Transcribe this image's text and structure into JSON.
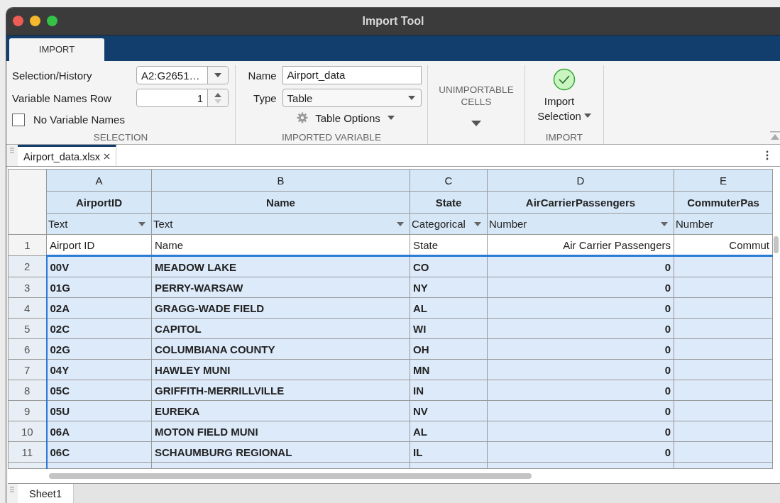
{
  "window": {
    "title": "Import Tool"
  },
  "ribbon_tabs": [
    {
      "label": "IMPORT",
      "selected": true
    }
  ],
  "selection": {
    "history_label": "Selection/History",
    "history_value": "A2:G2651…",
    "names_row_label": "Variable Names Row",
    "names_row_value": "1",
    "no_names_label": "No Variable Names",
    "no_names_checked": false,
    "section": "SELECTION"
  },
  "imported_variable": {
    "name_label": "Name",
    "name_value": "Airport_data",
    "type_label": "Type",
    "type_value": "Table",
    "options": "Table Options",
    "section": "IMPORTED VARIABLE"
  },
  "unimportable": {
    "label": "UNIMPORTABLE CELLS"
  },
  "import": {
    "button": "Import Selection",
    "section": "IMPORT"
  },
  "file_tabs": [
    {
      "label": "Airport_data.xlsx",
      "selected": true
    }
  ],
  "table": {
    "columns": [
      {
        "letter": "A",
        "name": "AirportID",
        "type": "Text",
        "kind": "text",
        "dropdown": true
      },
      {
        "letter": "B",
        "name": "Name",
        "type": "Text",
        "kind": "text",
        "dropdown": true
      },
      {
        "letter": "C",
        "name": "State",
        "type": "Categorical",
        "kind": "text",
        "dropdown": true
      },
      {
        "letter": "D",
        "name": "AirCarrierPassengers",
        "type": "Number",
        "kind": "numeric",
        "dropdown": true
      },
      {
        "letter": "E",
        "name": "CommuterPas",
        "type": "Number",
        "kind": "numeric",
        "dropdown": false
      }
    ],
    "rows": [
      {
        "number": "1",
        "selected": false,
        "cells": [
          "Airport ID",
          "Name",
          "State",
          "Air Carrier Passengers",
          "Commut"
        ]
      },
      {
        "number": "2",
        "selected": true,
        "cells": [
          "00V",
          "MEADOW LAKE",
          "CO",
          "0",
          ""
        ]
      },
      {
        "number": "3",
        "selected": true,
        "cells": [
          "01G",
          "PERRY-WARSAW",
          "NY",
          "0",
          ""
        ]
      },
      {
        "number": "4",
        "selected": true,
        "cells": [
          "02A",
          "GRAGG-WADE FIELD",
          "AL",
          "0",
          ""
        ]
      },
      {
        "number": "5",
        "selected": true,
        "cells": [
          "02C",
          "CAPITOL",
          "WI",
          "0",
          ""
        ]
      },
      {
        "number": "6",
        "selected": true,
        "cells": [
          "02G",
          "COLUMBIANA COUNTY",
          "OH",
          "0",
          ""
        ]
      },
      {
        "number": "7",
        "selected": true,
        "cells": [
          "04Y",
          "HAWLEY MUNI",
          "MN",
          "0",
          ""
        ]
      },
      {
        "number": "8",
        "selected": true,
        "cells": [
          "05C",
          "GRIFFITH-MERRILLVILLE",
          "IN",
          "0",
          ""
        ]
      },
      {
        "number": "9",
        "selected": true,
        "cells": [
          "05U",
          "EUREKA",
          "NV",
          "0",
          ""
        ]
      },
      {
        "number": "10",
        "selected": true,
        "cells": [
          "06A",
          "MOTON FIELD MUNI",
          "AL",
          "0",
          ""
        ]
      },
      {
        "number": "11",
        "selected": true,
        "cells": [
          "06C",
          "SCHAUMBURG REGIONAL",
          "IL",
          "0",
          ""
        ]
      }
    ]
  },
  "sheet_tabs": [
    {
      "label": "Sheet1",
      "selected": true
    }
  ]
}
